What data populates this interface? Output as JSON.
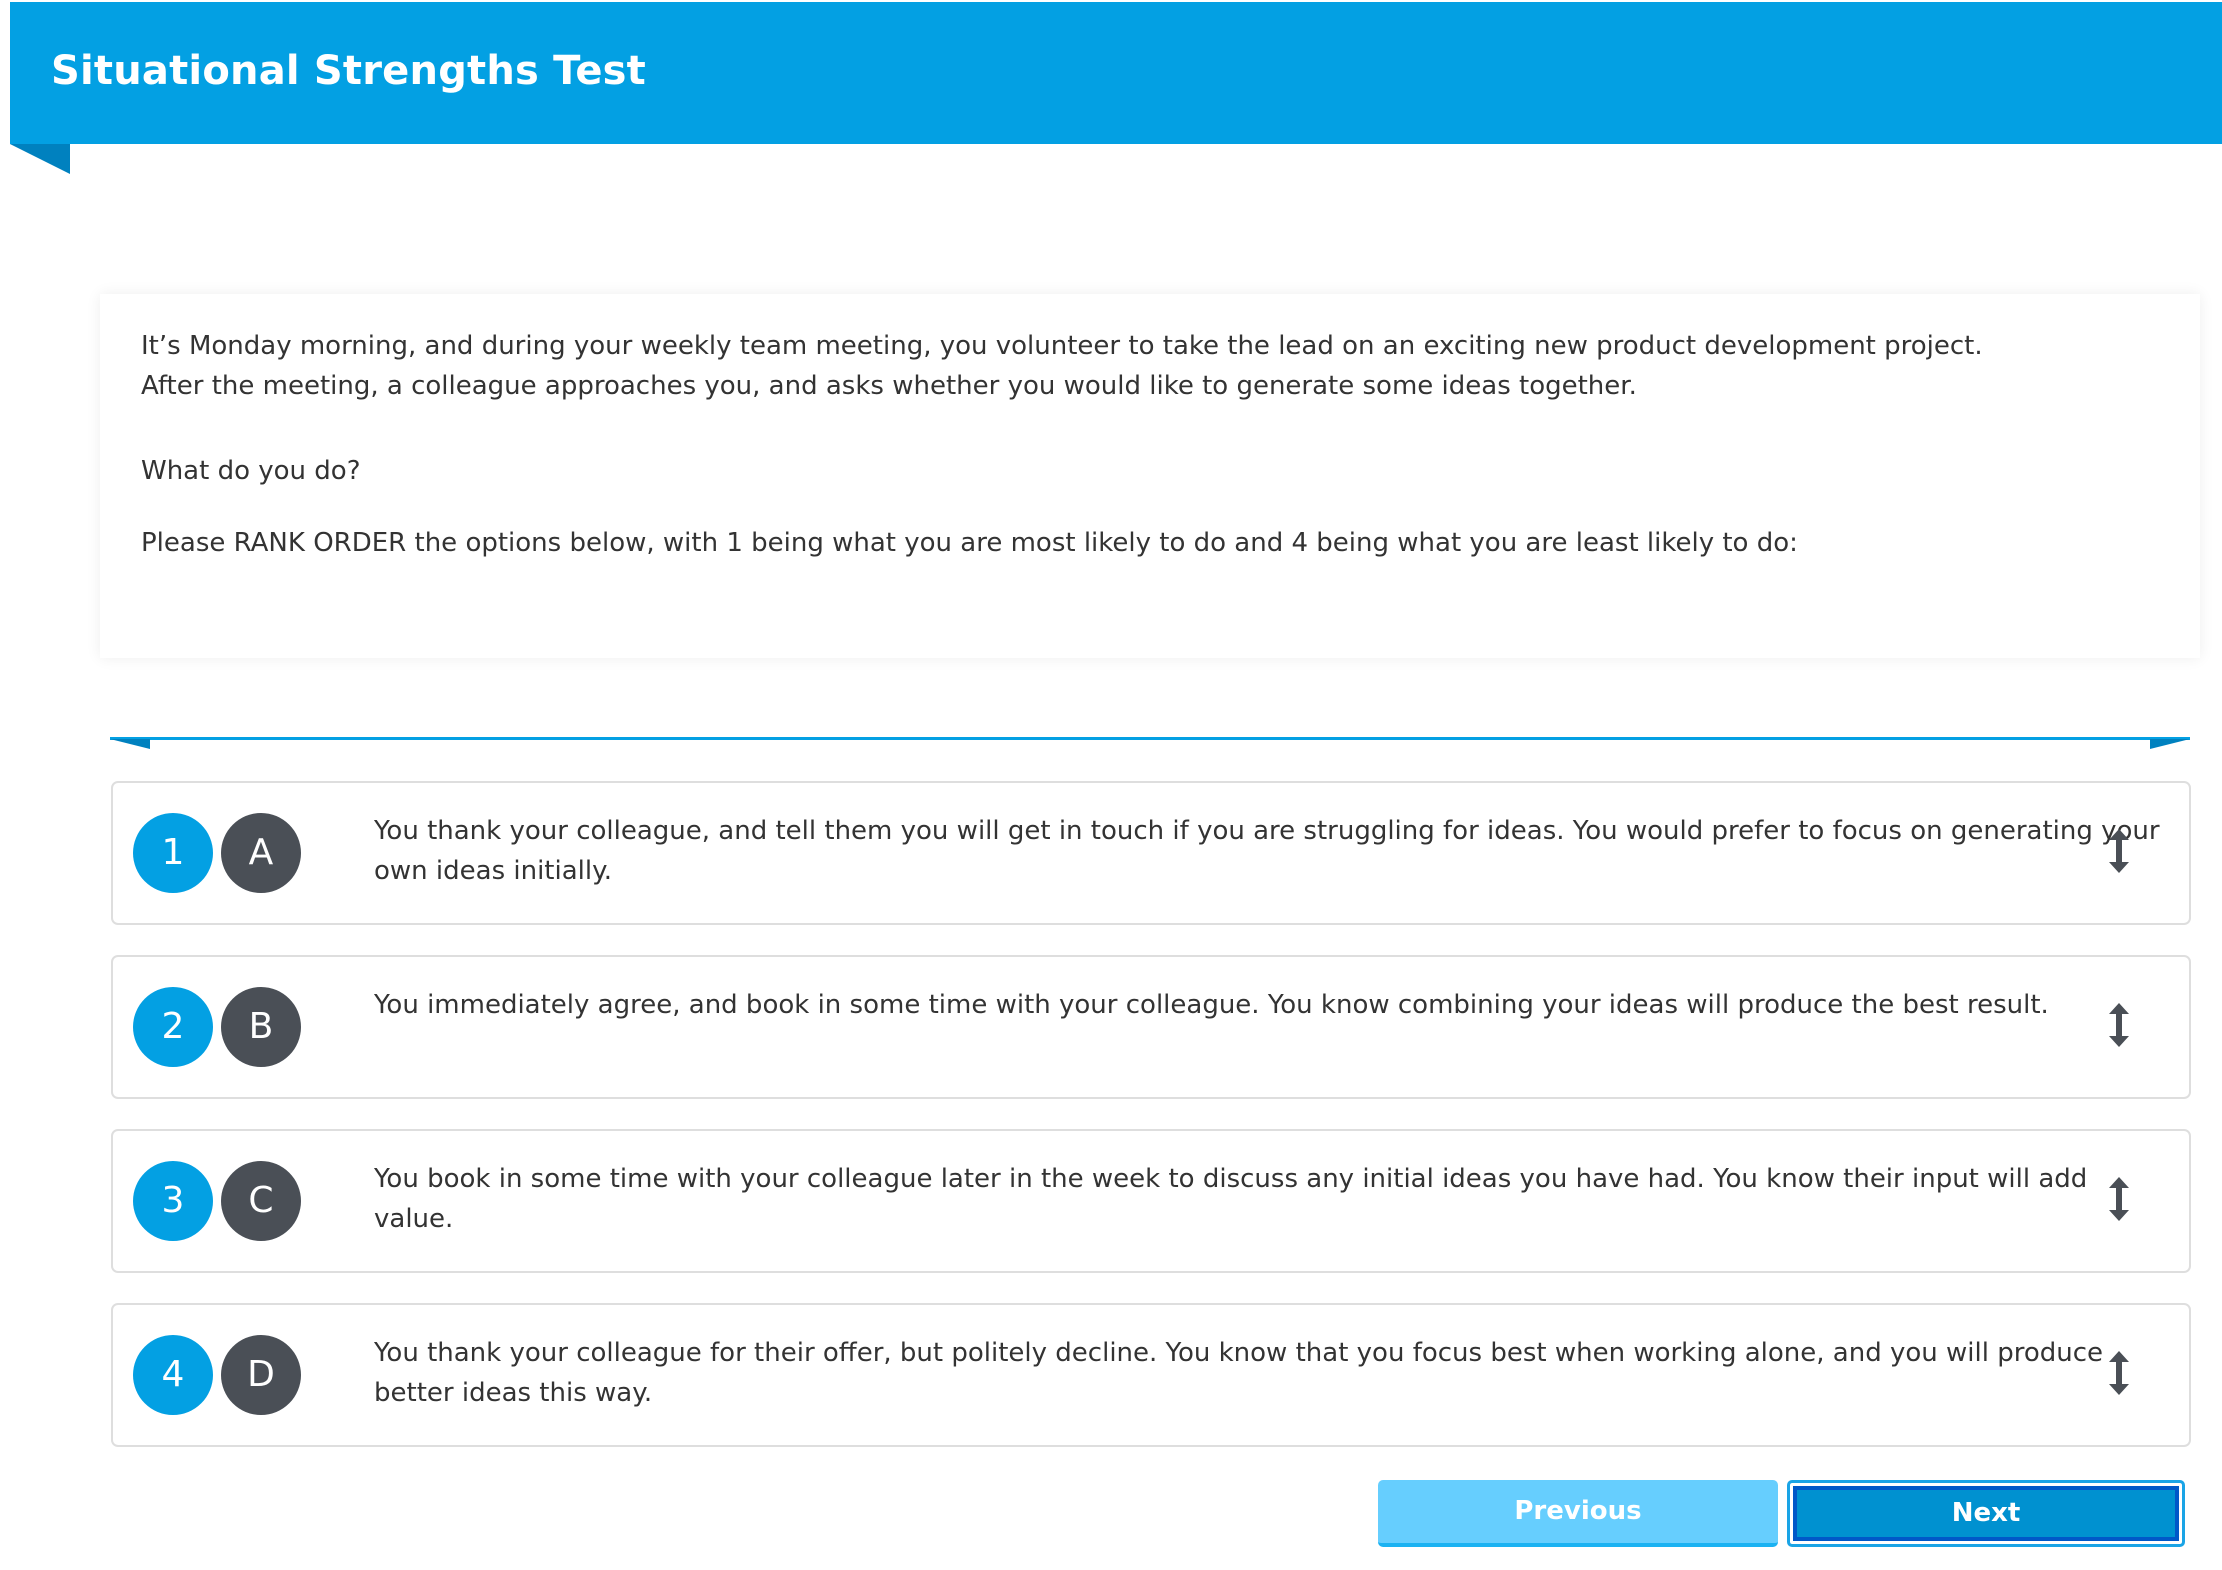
{
  "header": {
    "title": "Situational Strengths Test"
  },
  "scenario": {
    "paragraph_line1": "It’s Monday morning, and during your weekly team meeting, you volunteer to take the lead on an exciting new product development project.",
    "paragraph_line2": "After the meeting, a colleague approaches you, and asks whether you would like to generate some ideas together.",
    "question": "What do you do?",
    "instruction": "Please RANK ORDER the options below, with 1 being what you are most likely to do and 4 being what you are least likely to do:"
  },
  "options": [
    {
      "rank": "1",
      "letter": "A",
      "text": "You thank your colleague, and tell them you will get in touch if you are struggling for ideas. You would prefer to focus on generating your own ideas initially.",
      "handle_icon": "drag-vertical-icon"
    },
    {
      "rank": "2",
      "letter": "B",
      "text": "You immediately agree, and book in some time with your colleague. You know combining your ideas will produce the best result.",
      "handle_icon": "drag-vertical-icon"
    },
    {
      "rank": "3",
      "letter": "C",
      "text": "You book in some time with your colleague later in the week to discuss any initial ideas you have had. You know their input will add value.",
      "handle_icon": "drag-vertical-icon"
    },
    {
      "rank": "4",
      "letter": "D",
      "text": "You thank your colleague for their offer, but politely decline. You know that you focus best when working alone, and you will produce better ideas this way.",
      "handle_icon": "drag-vertical-icon"
    }
  ],
  "navigation": {
    "previous_label": "Previous",
    "next_label": "Next"
  },
  "colors": {
    "brand_blue": "#03A0E3",
    "fold_blue": "#0081BF",
    "letter_badge": "#4A4F56",
    "text": "#333333",
    "previous_button": "#66CEFE",
    "next_button": "#0091D0"
  }
}
